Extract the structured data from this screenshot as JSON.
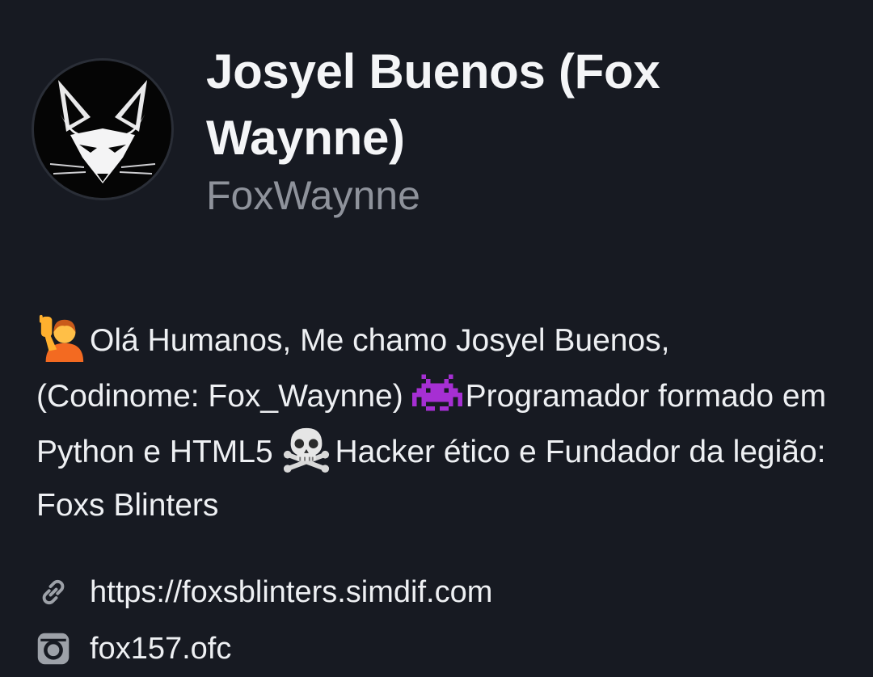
{
  "profile": {
    "display_name": "Josyel Buenos (Fox Waynne)",
    "username": "FoxWaynne",
    "avatar_icon": "white-fox-mask-logo"
  },
  "bio": {
    "emoji_1": "person-raising-hand-emoji",
    "part_1": "Olá Humanos, Me chamo Josyel Buenos, (Codinome: Fox_Waynne) ",
    "emoji_2": "alien-monster-emoji",
    "part_2": "Programador formado em Python e HTML5 ",
    "emoji_3": "skull-and-crossbones-emoji",
    "part_3": "Hacker ético e Fundador da legião: Foxs Blinters"
  },
  "links": {
    "website_icon": "link-icon",
    "website": "https://foxsblinters.simdif.com",
    "instagram_icon": "instagram-icon",
    "instagram": "fox157.ofc"
  },
  "colors": {
    "background": "#171a22",
    "text": "#f2f3f5",
    "muted": "#8e929b",
    "icon": "#9da1a8"
  }
}
